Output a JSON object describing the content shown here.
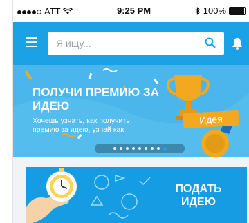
{
  "status_bar": {
    "carrier": "ATT",
    "time": "9:25 PM",
    "battery": "100%"
  },
  "app_bar": {
    "search": {
      "placeholder": "Я ищу..."
    }
  },
  "banner": {
    "title": "ПОЛУЧИ ПРЕМИЮ ЗА ИДЕЮ",
    "subtitle": "Хочешь узнать, как получить премию за идею, узнай как",
    "ribbon_text": "Идея",
    "pager": {
      "count": 9,
      "active_index": 8
    }
  },
  "cta_card": {
    "label": "ПОДАТЬ ИДЕЮ"
  },
  "colors": {
    "accent": "#1aa1e6",
    "banner": "#4bb6ec",
    "gold": "#f3a81f"
  }
}
